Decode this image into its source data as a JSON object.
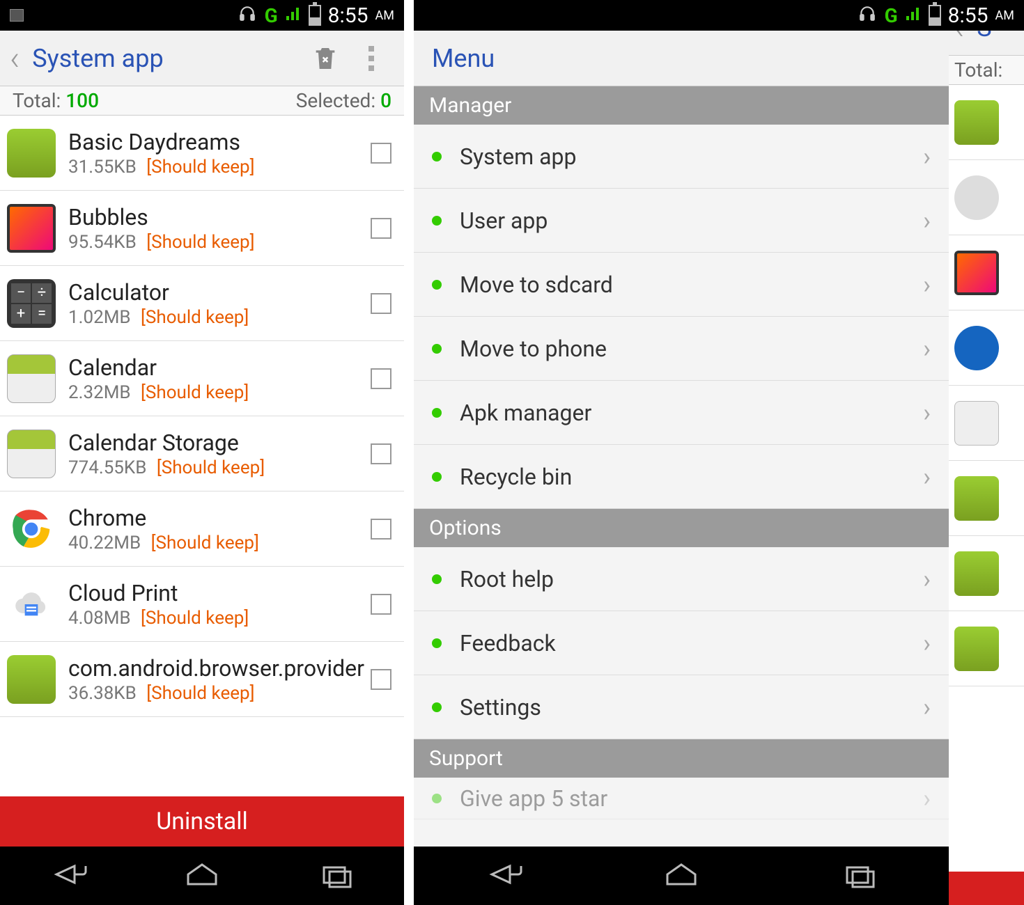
{
  "status": {
    "time": "8:55",
    "ampm": "AM",
    "network": "G"
  },
  "screen1": {
    "title": "System app",
    "total_label": "Total: ",
    "total_value": "100",
    "selected_label": "Selected: ",
    "selected_value": "0",
    "uninstall": "Uninstall",
    "apps": [
      {
        "name": "Basic Daydreams",
        "size": "31.55KB",
        "note": "[Should keep]",
        "icon": "ic-android"
      },
      {
        "name": "Bubbles",
        "size": "95.54KB",
        "note": "[Should keep]",
        "icon": "ic-bubbles"
      },
      {
        "name": "Calculator",
        "size": "1.02MB",
        "note": "[Should keep]",
        "icon": "ic-calc"
      },
      {
        "name": "Calendar",
        "size": "2.32MB",
        "note": "[Should keep]",
        "icon": "ic-calendar"
      },
      {
        "name": "Calendar Storage",
        "size": "774.55KB",
        "note": "[Should keep]",
        "icon": "ic-calendar"
      },
      {
        "name": "Chrome",
        "size": "40.22MB",
        "note": "[Should keep]",
        "icon": "ic-chrome"
      },
      {
        "name": "Cloud Print",
        "size": "4.08MB",
        "note": "[Should keep]",
        "icon": "ic-cloud"
      },
      {
        "name": "com.android.browser.provider",
        "size": "36.38KB",
        "note": "[Should keep]",
        "icon": "ic-android"
      }
    ]
  },
  "screen2": {
    "menu_title": "Menu",
    "sections": [
      {
        "header": "Manager",
        "items": [
          "System app",
          "User app",
          "Move to sdcard",
          "Move to phone",
          "Apk manager",
          "Recycle bin"
        ]
      },
      {
        "header": "Options",
        "items": [
          "Root help",
          "Feedback",
          "Settings"
        ]
      },
      {
        "header": "Support",
        "items": [
          "Give app 5 star"
        ]
      }
    ],
    "sliver_title_first": "S",
    "sliver_total": "Total:",
    "sliver_icons": [
      "ic-android",
      "ic-gear",
      "ic-bubbles",
      "ic-bt",
      "ic-doc",
      "ic-android",
      "ic-android",
      "ic-android"
    ]
  }
}
